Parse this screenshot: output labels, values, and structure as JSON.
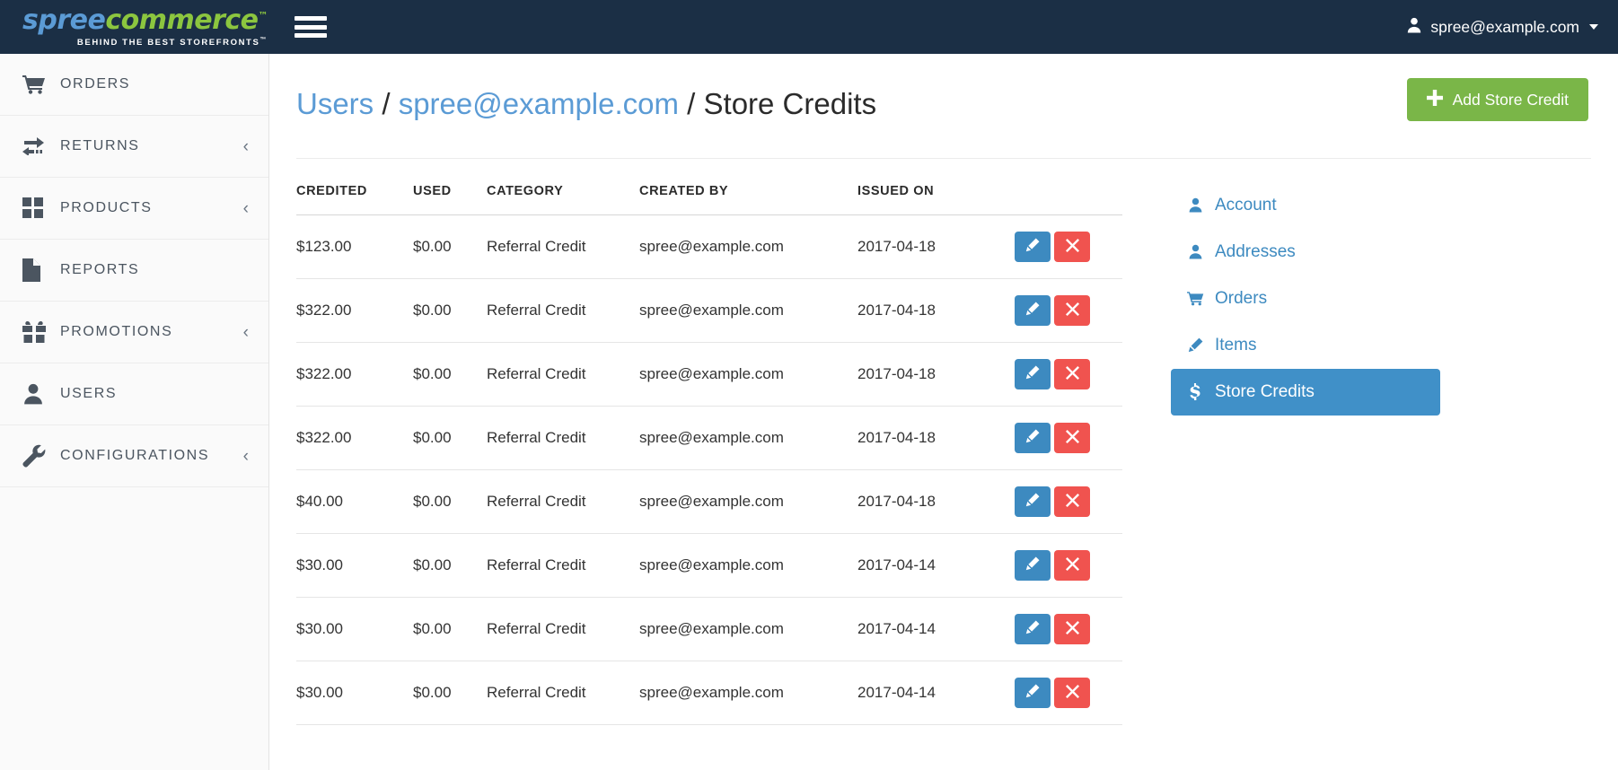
{
  "topbar": {
    "brand_spree": "spree",
    "brand_commerce": "commerce",
    "brand_tm": "™",
    "brand_tagline": "BEHIND THE BEST STOREFRONTS",
    "brand_tagline_tm": "™",
    "menu_icon": "hamburger-icon",
    "user_icon": "user-icon",
    "user_email": "spree@example.com",
    "caret_icon": "chevron-down-icon",
    "bg_color": "#1b2f45"
  },
  "sidebar": {
    "items": [
      {
        "label": "ORDERS",
        "icon": "cart-icon",
        "has_caret": false,
        "caret": "‹"
      },
      {
        "label": "RETURNS",
        "icon": "exchange-icon",
        "has_caret": true,
        "caret": "‹"
      },
      {
        "label": "PRODUCTS",
        "icon": "grid-icon",
        "has_caret": true,
        "caret": "‹"
      },
      {
        "label": "REPORTS",
        "icon": "document-icon",
        "has_caret": false,
        "caret": "‹"
      },
      {
        "label": "PROMOTIONS",
        "icon": "gift-icon",
        "has_caret": true,
        "caret": "‹"
      },
      {
        "label": "USERS",
        "icon": "user-icon",
        "has_caret": false,
        "caret": "‹"
      },
      {
        "label": "CONFIGURATIONS",
        "icon": "wrench-icon",
        "has_caret": true,
        "caret": "‹"
      }
    ]
  },
  "page": {
    "breadcrumb": {
      "users_link": "Users",
      "sep1": " / ",
      "email_link": "spree@example.com",
      "sep2": " / ",
      "current": "Store Credits"
    },
    "add_button": {
      "label": "Add Store Credit",
      "icon": "plus-icon",
      "color": "#7ab648"
    }
  },
  "table": {
    "headers": [
      "CREDITED",
      "USED",
      "CATEGORY",
      "CREATED BY",
      "ISSUED ON"
    ],
    "rows": [
      {
        "credited": "$123.00",
        "used": "$0.00",
        "category": "Referral Credit",
        "created_by": "spree@example.com",
        "issued_on": "2017-04-18"
      },
      {
        "credited": "$322.00",
        "used": "$0.00",
        "category": "Referral Credit",
        "created_by": "spree@example.com",
        "issued_on": "2017-04-18"
      },
      {
        "credited": "$322.00",
        "used": "$0.00",
        "category": "Referral Credit",
        "created_by": "spree@example.com",
        "issued_on": "2017-04-18"
      },
      {
        "credited": "$322.00",
        "used": "$0.00",
        "category": "Referral Credit",
        "created_by": "spree@example.com",
        "issued_on": "2017-04-18"
      },
      {
        "credited": "$40.00",
        "used": "$0.00",
        "category": "Referral Credit",
        "created_by": "spree@example.com",
        "issued_on": "2017-04-18"
      },
      {
        "credited": "$30.00",
        "used": "$0.00",
        "category": "Referral Credit",
        "created_by": "spree@example.com",
        "issued_on": "2017-04-14"
      },
      {
        "credited": "$30.00",
        "used": "$0.00",
        "category": "Referral Credit",
        "created_by": "spree@example.com",
        "issued_on": "2017-04-14"
      },
      {
        "credited": "$30.00",
        "used": "$0.00",
        "category": "Referral Credit",
        "created_by": "spree@example.com",
        "issued_on": "2017-04-14"
      }
    ],
    "actions": {
      "edit_icon": "pencil-icon",
      "delete_icon": "close-x-icon",
      "edit_color": "#3d8ac0",
      "delete_color": "#f0534f"
    }
  },
  "user_nav": {
    "items": [
      {
        "label": "Account",
        "icon": "user-icon",
        "active": false
      },
      {
        "label": "Addresses",
        "icon": "user-icon",
        "active": false
      },
      {
        "label": "Orders",
        "icon": "cart-icon",
        "active": false
      },
      {
        "label": "Items",
        "icon": "pencil-icon",
        "active": false
      },
      {
        "label": "Store Credits",
        "icon": "dollar-icon",
        "active": true
      }
    ],
    "active_color": "#4090c8",
    "link_color": "#3d8ac0"
  }
}
